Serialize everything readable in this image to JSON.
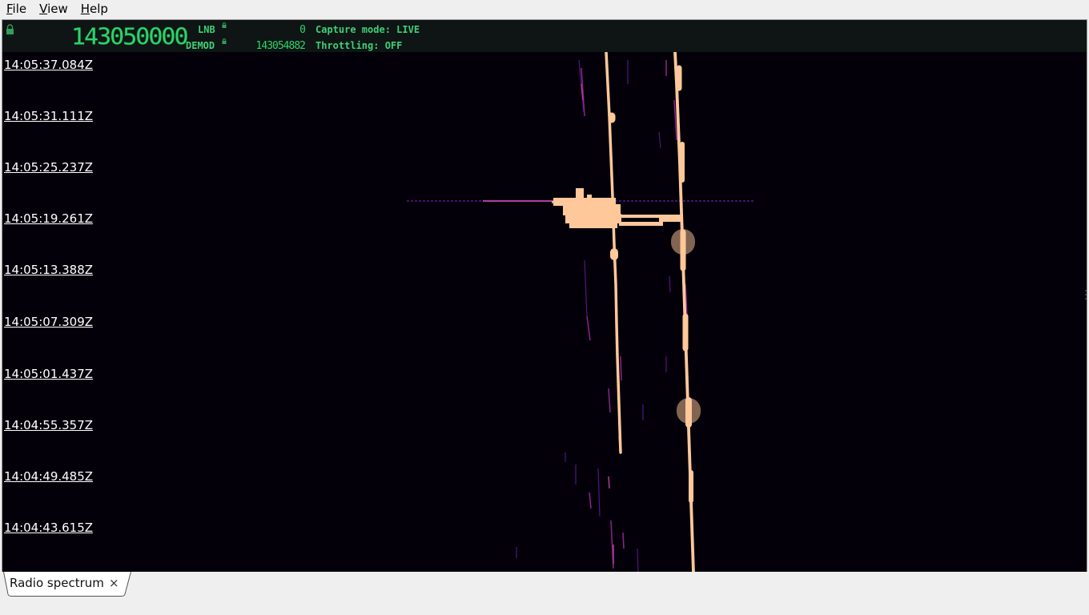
{
  "menu": {
    "file": {
      "accel": "F",
      "rest": "ile"
    },
    "view": {
      "accel": "V",
      "rest": "iew"
    },
    "help": {
      "accel": "H",
      "rest": "elp"
    }
  },
  "info": {
    "main_frequency": "143050000",
    "lnb_label": "LNB",
    "lnb_value": "0",
    "demod_label": "DEMOD",
    "demod_value": "143054882",
    "capture_mode": "Capture mode: LIVE",
    "throttling": "Throttling: OFF"
  },
  "timestamps": [
    "14:05:37.084Z",
    "14:05:31.111Z",
    "14:05:25.237Z",
    "14:05:19.261Z",
    "14:05:13.388Z",
    "14:05:07.309Z",
    "14:05:01.437Z",
    "14:04:55.357Z",
    "14:04:49.485Z",
    "14:04:43.615Z"
  ],
  "tab": {
    "label": "Radio spectrum",
    "close": "×"
  },
  "colors": {
    "lcd_green": "#2bd36a",
    "waterfall_bg": "#04000a",
    "signal_hot": "#ffc89a",
    "signal_mid": "#c0409a",
    "signal_low": "#5a1a8a"
  },
  "icons": [
    "lock-icon"
  ]
}
